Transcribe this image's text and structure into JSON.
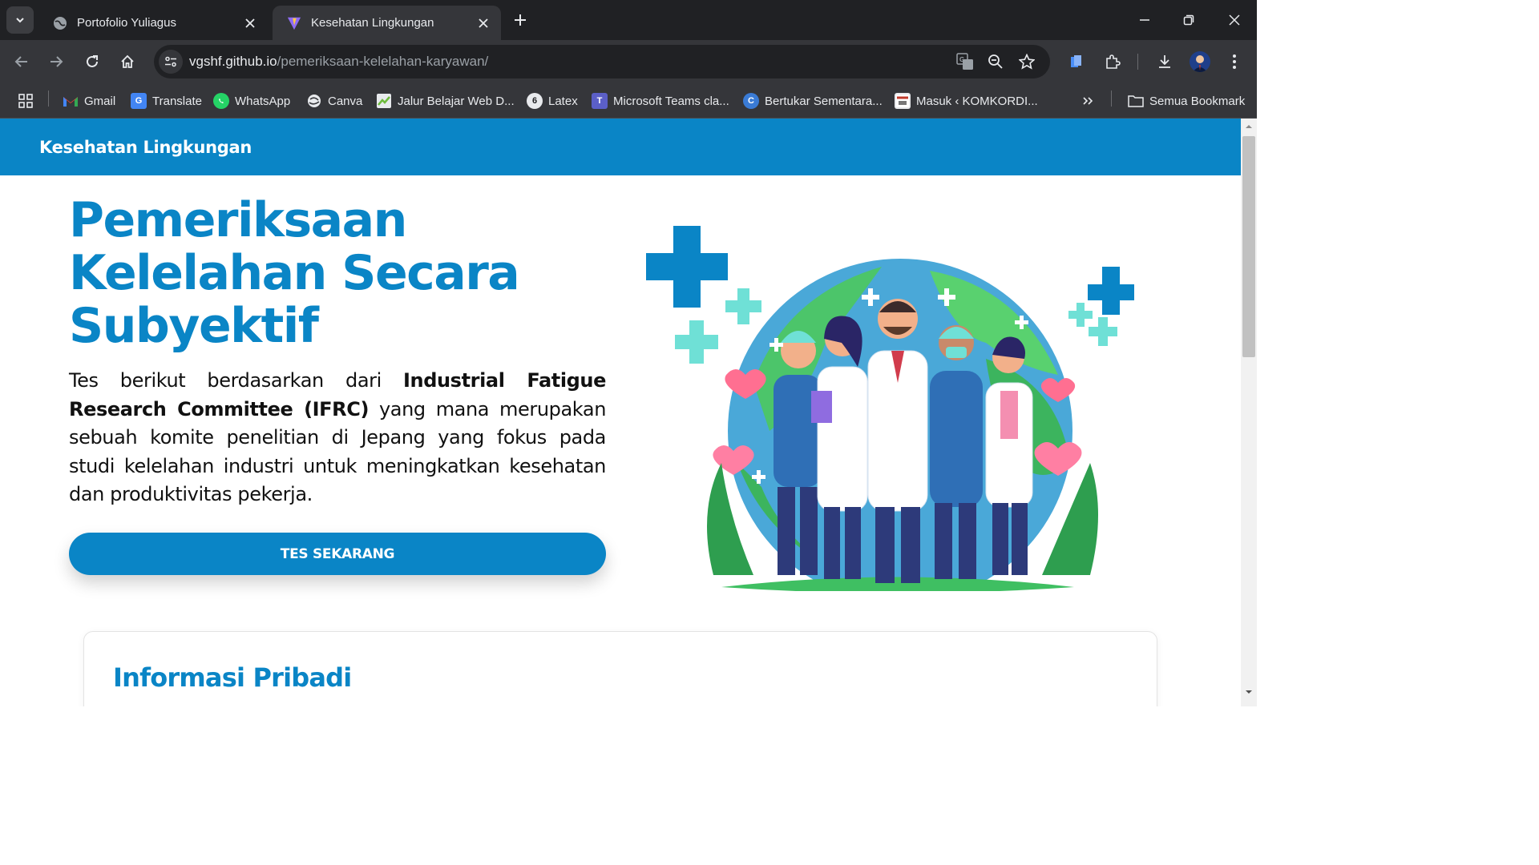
{
  "browser": {
    "tabs": [
      {
        "title": "Portofolio Yuliagus",
        "active": false
      },
      {
        "title": "Kesehatan Lingkungan",
        "active": true
      }
    ],
    "url_domain": "vgshf.github.io",
    "url_path": "/pemeriksaan-kelelahan-karyawan/",
    "bookmarks": [
      {
        "label": "Gmail",
        "icon": "gmail-icon"
      },
      {
        "label": "Translate",
        "icon": "translate-icon"
      },
      {
        "label": "WhatsApp",
        "icon": "whatsapp-icon"
      },
      {
        "label": "Canva",
        "icon": "canva-icon"
      },
      {
        "label": "Jalur Belajar Web D...",
        "icon": "learning-path-icon"
      },
      {
        "label": "Latex",
        "icon": "latex-icon"
      },
      {
        "label": "Microsoft Teams cla...",
        "icon": "teams-icon"
      },
      {
        "label": "Bertukar Sementara...",
        "icon": "exchange-icon"
      },
      {
        "label": "Masuk ‹ KOMKORDI...",
        "icon": "komkordi-icon"
      }
    ],
    "all_bookmarks": "Semua Bookmark"
  },
  "page": {
    "brand": "Kesehatan Lingkungan",
    "hero": {
      "title": "Pemeriksaan Kelelahan Secara Subyektif",
      "desc_intro": "Tes berikut berdasarkan dari ",
      "desc_bold": "Industrial Fatigue Research Committee (IFRC)",
      "desc_rest": " yang mana merupakan sebuah komite penelitian di Jepang yang fokus pada studi kelelahan industri untuk meningkatkan kesehatan dan produktivitas pekerja.",
      "cta": "TES SEKARANG"
    },
    "section_title": "Informasi Pribadi"
  },
  "colors": {
    "primary": "#0a85c6",
    "chrome_dark": "#202124",
    "chrome_toolbar": "#35363a"
  }
}
